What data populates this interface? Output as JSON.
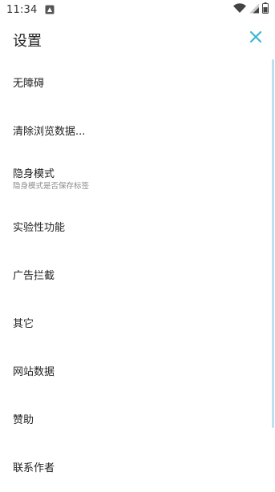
{
  "status_bar": {
    "time": "11:34"
  },
  "header": {
    "title": "设置",
    "close_icon": "close-icon"
  },
  "colors": {
    "accent": "#3fb5d6",
    "scrollbar": "#b9e3f0"
  },
  "settings": {
    "items": [
      {
        "label": "无障碍"
      },
      {
        "label": "清除浏览数据..."
      },
      {
        "label": "隐身模式",
        "sublabel": "隐身模式是否保存标签"
      },
      {
        "label": "实验性功能"
      },
      {
        "label": "广告拦截"
      },
      {
        "label": "其它"
      },
      {
        "label": "网站数据"
      },
      {
        "label": "赞助"
      },
      {
        "label": "联系作者"
      }
    ]
  }
}
